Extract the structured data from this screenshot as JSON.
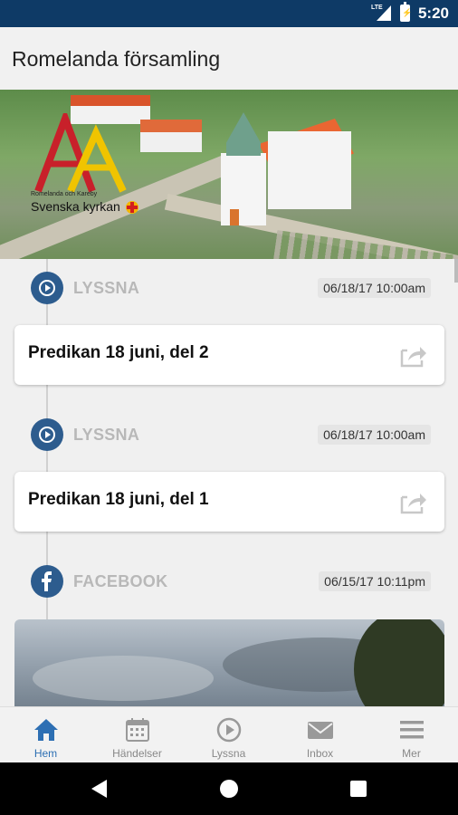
{
  "status_bar": {
    "time": "5:20",
    "network": "LTE",
    "battery_icon": "battery-charging-icon",
    "signal_icon": "signal-icon"
  },
  "app_bar": {
    "title": "Romelanda församling"
  },
  "hero": {
    "image": "church-aerial-photo",
    "logo": {
      "subtitle": "Romelanda och Kareby",
      "name": "Svenska kyrkan"
    }
  },
  "feed": [
    {
      "type": "LYSSNA",
      "icon": "play-icon",
      "date": "06/18/17 10:00am",
      "title": "Predikan 18 juni, del 2",
      "action_icon": "share-icon"
    },
    {
      "type": "LYSSNA",
      "icon": "play-icon",
      "date": "06/18/17 10:00am",
      "title": "Predikan 18 juni, del 1",
      "action_icon": "share-icon"
    },
    {
      "type": "FACEBOOK",
      "icon": "facebook-icon",
      "date": "06/15/17 10:11pm"
    }
  ],
  "bottom_nav": [
    {
      "label": "Hem",
      "icon": "home-icon",
      "active": true
    },
    {
      "label": "Händelser",
      "icon": "calendar-icon",
      "active": false
    },
    {
      "label": "Lyssna",
      "icon": "play-circle-icon",
      "active": false
    },
    {
      "label": "Inbox",
      "icon": "mail-icon",
      "active": false
    },
    {
      "label": "Mer",
      "icon": "menu-icon",
      "active": false
    }
  ],
  "colors": {
    "status_bar": "#0e3a66",
    "accent": "#2d5c8e",
    "active_nav": "#2d6fb3",
    "header_text_muted": "#b8b8b8"
  }
}
